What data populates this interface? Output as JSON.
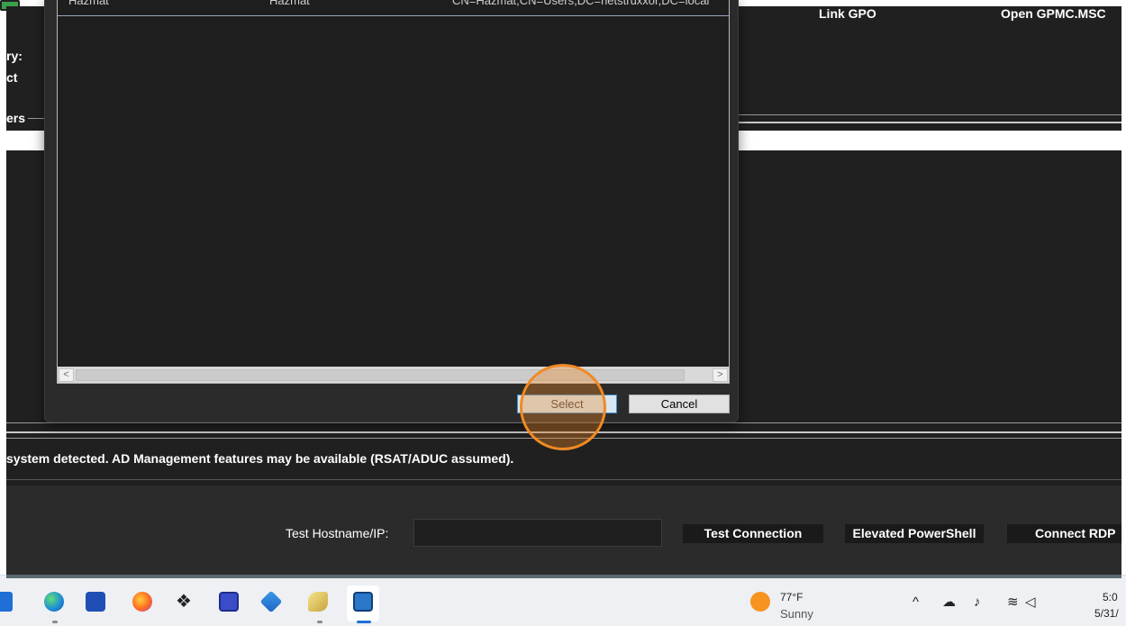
{
  "app": {
    "top_right_buttons": {
      "link_gpo": "Link GPO",
      "open_gpmc": "Open GPMC.MSC"
    },
    "left_labels": {
      "label_1": "ry:",
      "label_2": "ct",
      "group": "ers"
    },
    "status_message": "system detected. AD Management features may be available (RSAT/ADUC assumed).",
    "bottom": {
      "host_label": "Test Hostname/IP:",
      "host_value": "",
      "test_connection": "Test Connection",
      "elevated_powershell": "Elevated PowerShell",
      "connect_rdp": "Connect RDP"
    }
  },
  "dialog": {
    "row": {
      "name": "Hazmat",
      "sam": "Hazmat",
      "dn": "CN=Hazmat,CN=Users,DC=netstruxxor,DC=local"
    },
    "scroll_left": "<",
    "scroll_right": ">",
    "select_label": "Select",
    "cancel_label": "Cancel"
  },
  "taskbar": {
    "weather_temp": "77°F",
    "weather_desc": "Sunny",
    "clock_time": "5:0",
    "clock_date": "5/31/",
    "icons": [
      "file-explorer-icon",
      "edge-icon",
      "store-icon",
      "firefox-icon",
      "dropbox-icon",
      "app-icon",
      "app-icon",
      "app-icon",
      "app-icon"
    ]
  },
  "colors": {
    "app_background": "#202020",
    "dialog_background": "#2b2b2b",
    "select_accent": "#3c8fd8",
    "click_highlight": "#f08a24",
    "taskbar_background": "#eef0f3"
  }
}
